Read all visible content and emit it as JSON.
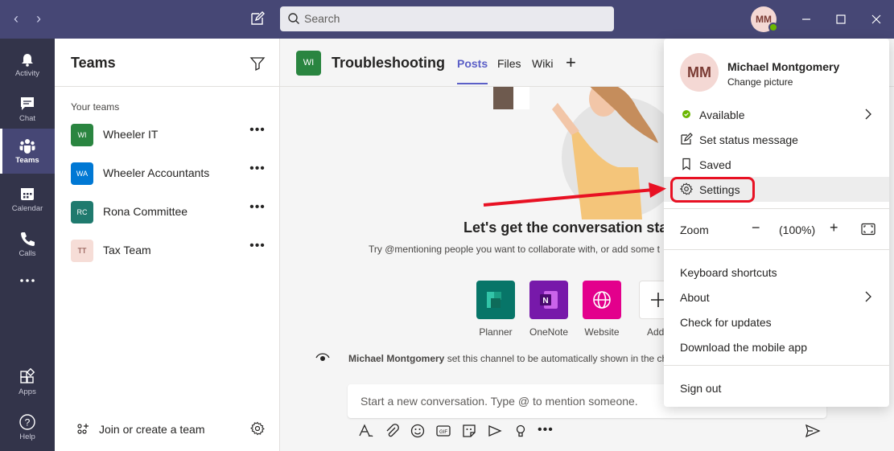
{
  "titlebar": {
    "search_placeholder": "Search",
    "avatar_initials": "MM",
    "colors": {
      "bar": "#464775",
      "status_available": "#6bb700"
    }
  },
  "rail": {
    "items": [
      {
        "label": "Activity",
        "icon": "bell-icon"
      },
      {
        "label": "Chat",
        "icon": "chat-icon"
      },
      {
        "label": "Teams",
        "icon": "teams-icon",
        "active": true
      },
      {
        "label": "Calendar",
        "icon": "calendar-icon"
      },
      {
        "label": "Calls",
        "icon": "phone-icon"
      },
      {
        "label": "",
        "icon": "more-icon"
      },
      {
        "label": "Apps",
        "icon": "apps-icon"
      },
      {
        "label": "Help",
        "icon": "help-icon"
      }
    ]
  },
  "teams_panel": {
    "title": "Teams",
    "section_label": "Your teams",
    "teams": [
      {
        "initials": "WI",
        "name": "Wheeler IT",
        "color": "#2a8540"
      },
      {
        "initials": "WA",
        "name": "Wheeler Accountants",
        "color": "#0078d4"
      },
      {
        "initials": "RC",
        "name": "Rona Committee",
        "color": "#1f7a6e"
      },
      {
        "initials": "TT",
        "name": "Tax Team",
        "color": "#f6ddd7"
      }
    ],
    "join_label": "Join or create a team"
  },
  "channel": {
    "tile_initials": "WI",
    "title": "Troubleshooting",
    "tabs": [
      "Posts",
      "Files",
      "Wiki"
    ],
    "active_tab": "Posts",
    "welcome_title": "Let's get the conversation sta",
    "welcome_sub": "Try @mentioning people you want to collaborate with, or add some t",
    "apps": [
      {
        "label": "Planner",
        "color": "#077568",
        "icon": "planner-icon"
      },
      {
        "label": "OneNote",
        "color": "#7719aa",
        "icon": "onenote-icon"
      },
      {
        "label": "Website",
        "color": "#e3008c",
        "icon": "globe-icon"
      },
      {
        "label": "Add t",
        "color": "#ffffff",
        "icon": "plus-icon"
      }
    ],
    "system_message": {
      "author": "Michael Montgomery",
      "text": " set this channel to be automatically shown in the ch"
    },
    "compose_placeholder": "Start a new conversation. Type @ to mention someone."
  },
  "profile_menu": {
    "avatar_initials": "MM",
    "name": "Michael Montgomery",
    "change_picture": "Change picture",
    "items": [
      {
        "label": "Available",
        "icon": "available-status-icon"
      },
      {
        "label": "Set status message",
        "icon": "edit-icon"
      },
      {
        "label": "Saved",
        "icon": "bookmark-icon"
      },
      {
        "label": "Settings",
        "icon": "gear-icon"
      }
    ],
    "zoom": {
      "label": "Zoom",
      "minus": "−",
      "value": "(100%)",
      "plus": "+"
    },
    "links": [
      "Keyboard shortcuts",
      "About",
      "Check for updates",
      "Download the mobile app"
    ],
    "sign_out": "Sign out"
  },
  "annotation": {
    "color": "#e81123"
  }
}
